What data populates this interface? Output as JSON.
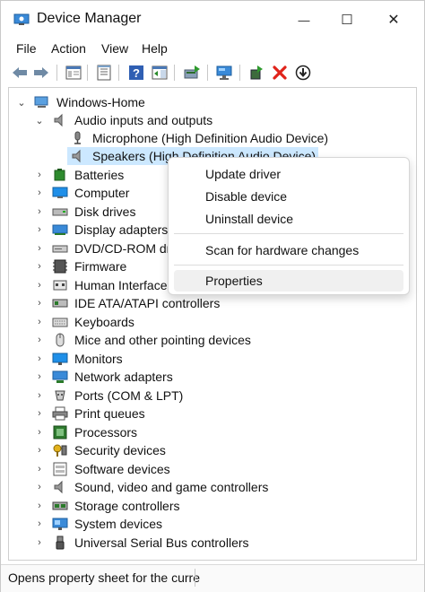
{
  "window": {
    "title": "Device Manager",
    "min_glyph": "—",
    "max_glyph": "☐",
    "close_glyph": "✕"
  },
  "menu": [
    {
      "label": "File",
      "id": "file"
    },
    {
      "label": "Action",
      "id": "action"
    },
    {
      "label": "View",
      "id": "view"
    },
    {
      "label": "Help",
      "id": "help"
    }
  ],
  "toolbar": [
    {
      "id": "back",
      "icon": "back-arrow-icon"
    },
    {
      "id": "forward",
      "icon": "forward-arrow-icon"
    },
    {
      "id": "show-hide-tree",
      "icon": "console-tree-icon"
    },
    {
      "id": "properties",
      "icon": "properties-sheet-icon"
    },
    {
      "id": "help",
      "icon": "help-icon"
    },
    {
      "id": "action-pane",
      "icon": "action-pane-icon"
    },
    {
      "id": "update-driver",
      "icon": "update-driver-icon"
    },
    {
      "id": "scan-hardware",
      "icon": "monitor-scan-icon"
    },
    {
      "id": "enable-device",
      "icon": "enable-device-icon"
    },
    {
      "id": "uninstall",
      "icon": "red-x-icon"
    },
    {
      "id": "disable",
      "icon": "down-arrow-circle-icon"
    }
  ],
  "tree": {
    "root": "Windows-Home",
    "audio": {
      "label": "Audio inputs and outputs",
      "children": [
        "Microphone (High Definition Audio Device)",
        "Speakers (High Definition Audio Device)"
      ]
    },
    "categories": [
      {
        "label": "Batteries",
        "icon": "battery-icon"
      },
      {
        "label": "Computer",
        "icon": "computer-icon"
      },
      {
        "label": "Disk drives",
        "icon": "disk-drive-icon"
      },
      {
        "label": "Display adapters",
        "icon": "display-adapter-icon"
      },
      {
        "label": "DVD/CD-ROM drives",
        "icon": "dvd-drive-icon"
      },
      {
        "label": "Firmware",
        "icon": "firmware-icon"
      },
      {
        "label": "Human Interface Devices",
        "icon": "hid-icon"
      },
      {
        "label": "IDE ATA/ATAPI controllers",
        "icon": "ide-controller-icon"
      },
      {
        "label": "Keyboards",
        "icon": "keyboard-icon"
      },
      {
        "label": "Mice and other pointing devices",
        "icon": "mouse-icon"
      },
      {
        "label": "Monitors",
        "icon": "monitor-icon"
      },
      {
        "label": "Network adapters",
        "icon": "network-adapter-icon"
      },
      {
        "label": "Ports (COM & LPT)",
        "icon": "port-icon"
      },
      {
        "label": "Print queues",
        "icon": "printer-icon"
      },
      {
        "label": "Processors",
        "icon": "processor-icon"
      },
      {
        "label": "Security devices",
        "icon": "security-device-icon"
      },
      {
        "label": "Software devices",
        "icon": "software-device-icon"
      },
      {
        "label": "Sound, video and game controllers",
        "icon": "speaker-icon"
      },
      {
        "label": "Storage controllers",
        "icon": "storage-controller-icon"
      },
      {
        "label": "System devices",
        "icon": "system-device-icon"
      },
      {
        "label": "Universal Serial Bus controllers",
        "icon": "usb-icon"
      }
    ]
  },
  "context_menu": {
    "items": [
      "Update driver",
      "Disable device",
      "Uninstall device",
      "Scan for hardware changes",
      "Properties"
    ]
  },
  "status": {
    "text": "Opens property sheet for the curre"
  },
  "colors": {
    "selection": "#cce8ff",
    "accent": "#0a64c8",
    "hover": "#f0f0f0"
  }
}
